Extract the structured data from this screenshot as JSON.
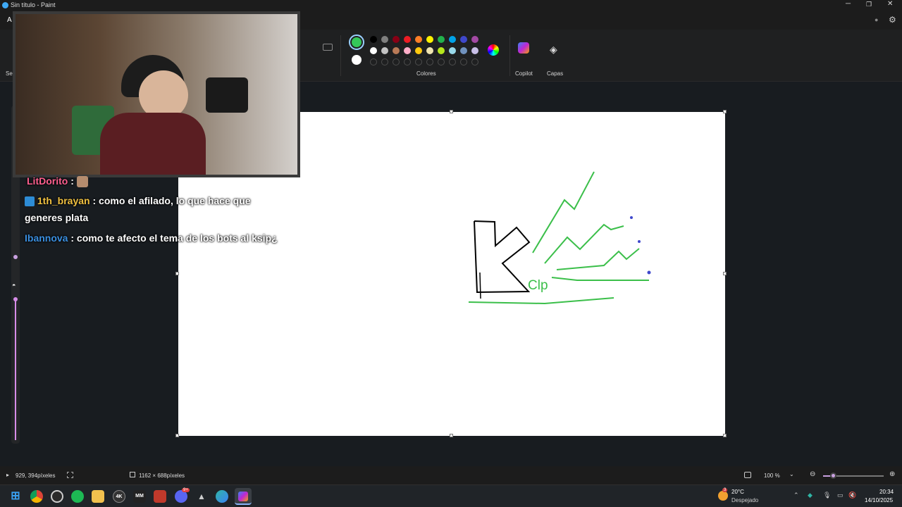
{
  "titlebar": {
    "title": "Sin título - Paint"
  },
  "menubar": {
    "letter": "A"
  },
  "ribbon": {
    "left_label": "Sel",
    "colors_label": "Colores",
    "copilot_label": "Copilot",
    "layers_label": "Capas",
    "primary_color": "#34c759",
    "secondary_color": "#ffffff",
    "palette_row1": [
      "#000000",
      "#7f7f7f",
      "#880015",
      "#ed1c24",
      "#ff7f27",
      "#fff200",
      "#22b14c",
      "#00a2e8",
      "#3f48cc",
      "#a349a4"
    ],
    "palette_row2": [
      "#ffffff",
      "#c3c3c3",
      "#b97a57",
      "#ffaec9",
      "#ffc90e",
      "#efe4b0",
      "#b5e61d",
      "#99d9ea",
      "#7092be",
      "#c8bfe7"
    ]
  },
  "chat": {
    "messages": [
      {
        "user": "LitDorito",
        "sep": " :",
        "text": ""
      },
      {
        "user": "1th_brayan",
        "sep": " : ",
        "text": "como el afilado, lo que hace que generes plata"
      },
      {
        "user": "Ibannova",
        "sep": " : ",
        "text": "como te afecto el tema de los bots al ksip¿"
      }
    ]
  },
  "drawing": {
    "handwritten": "Clp",
    "letter": "K"
  },
  "statusbar": {
    "cursor": "929, 394píxeles",
    "size": "1162 × 688píxeles",
    "zoom": "100 %"
  },
  "taskbar": {
    "weather_temp": "20°C",
    "weather_desc": "Despejado",
    "time": "20:34",
    "date": "14/10/2025",
    "badge_weather": "3",
    "badge_discord": "9+",
    "apps": [
      "windows",
      "chrome",
      "obs",
      "spotify",
      "explorer",
      "4k",
      "mm",
      "rockstar",
      "discord",
      "rocket",
      "edge",
      "copilot-paint"
    ]
  }
}
